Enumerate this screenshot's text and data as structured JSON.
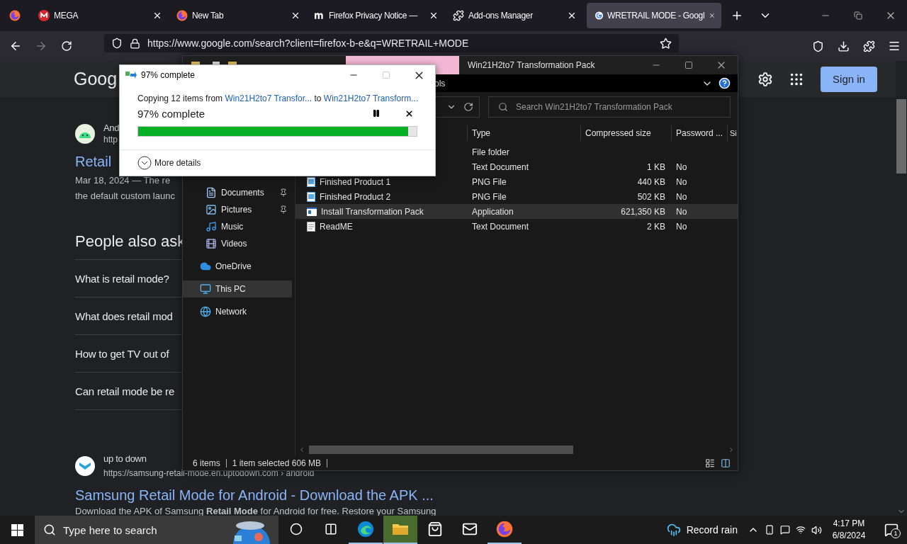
{
  "browser": {
    "tabs": [
      {
        "title": "MEGA",
        "kind": "mega",
        "selected": false
      },
      {
        "title": "New Tab",
        "kind": "firefox",
        "selected": false
      },
      {
        "title": "Firefox Privacy Notice —",
        "kind": "mozilla",
        "selected": false
      },
      {
        "title": "Add-ons Manager",
        "kind": "puzzle",
        "selected": false
      },
      {
        "title": "WRETRAIL MODE - Googl",
        "kind": "google",
        "selected": true
      }
    ],
    "url": "https://www.google.com/search?client=firefox-b-e&q=WRETRAIL+MODE"
  },
  "google": {
    "logo": "Goog",
    "sign_in": "Sign in",
    "first_result": {
      "kind": "android",
      "site": "And",
      "url": "http",
      "title": "Retail",
      "snippet": [
        "Mar 18, 2024 — The re",
        "the default custom launc"
      ]
    },
    "people_also_ask": {
      "title": "People also ask",
      "questions": [
        "What is retail mode?",
        "What does retail mod",
        "How to get TV out of",
        "Can retail mode be re"
      ]
    },
    "second_result": {
      "kind": "uptodown",
      "site": "up to down",
      "url": "https://samsung-retail-mode.en.uptodown.com › android",
      "title": "Samsung Retail Mode for Android - Download the APK ...",
      "snippet": [
        "Download the APK of Samsung **Retail Mode** for Android for free. Restore your Samsung"
      ]
    }
  },
  "explorer": {
    "title": "Win21H2to7 Transformation Pack",
    "ribbon_tab": "ols",
    "search_placeholder": "Search Win21H2to7 Transformation Pack",
    "nav": {
      "quick_access": [
        {
          "label": "Documents",
          "kind": "documents",
          "pinned": true,
          "selected": false
        },
        {
          "label": "Pictures",
          "kind": "pictures",
          "pinned": true,
          "selected": false
        },
        {
          "label": "Music",
          "kind": "music",
          "pinned": false,
          "selected": false
        },
        {
          "label": "Videos",
          "kind": "videos",
          "pinned": false,
          "selected": false
        }
      ],
      "locations": [
        {
          "label": "OneDrive",
          "kind": "cloud",
          "selected": false
        },
        {
          "label": "This PC",
          "kind": "pc",
          "selected": true
        },
        {
          "label": "Network",
          "kind": "network",
          "selected": false
        }
      ]
    },
    "columns": [
      "Type",
      "Compressed size",
      "Password ...",
      "Si"
    ],
    "rows": [
      {
        "type": "File folder",
        "selected": false
      },
      {
        "type": "Text Document",
        "size": "1 KB",
        "password": "No",
        "selected": false
      },
      {
        "name": "Finished Product 1",
        "kind": "png",
        "type": "PNG File",
        "size": "440 KB",
        "password": "No",
        "selected": false
      },
      {
        "name": "Finished Product 2",
        "kind": "png",
        "type": "PNG File",
        "size": "502 KB",
        "password": "No",
        "selected": false
      },
      {
        "name": "Install Transformation Pack",
        "kind": "app",
        "type": "Application",
        "size": "621,350 KB",
        "password": "No",
        "selected": true
      },
      {
        "name": "ReadME",
        "kind": "text",
        "type": "Text Document",
        "size": "2 KB",
        "password": "No",
        "selected": false
      }
    ],
    "status": {
      "count": "6 items",
      "selection": "1 item selected  606 MB"
    }
  },
  "copy_dialog": {
    "title": "97% complete",
    "prefix": "Copying 12 items from",
    "source": "Win21H2to7 Transfor...",
    "middle": "to",
    "destination": "Win21H2to7 Transform...",
    "heading": "97% complete",
    "level": 0.97,
    "details": "More details"
  },
  "taskbar": {
    "search_placeholder": "Type here to search",
    "apps": [
      {
        "kind": "cortana",
        "running": false,
        "active": false
      },
      {
        "kind": "taskview",
        "running": false,
        "active": false
      },
      {
        "kind": "edge",
        "running": true,
        "active": false
      },
      {
        "kind": "explorer",
        "running": true,
        "active": true
      },
      {
        "kind": "store",
        "running": false,
        "active": false
      },
      {
        "kind": "mail",
        "running": false,
        "active": false
      },
      {
        "kind": "firefox",
        "running": true,
        "active": false
      }
    ],
    "weather": "Record rain",
    "time": "4:17 PM",
    "date": "6/8/2024",
    "notifications": "1"
  }
}
